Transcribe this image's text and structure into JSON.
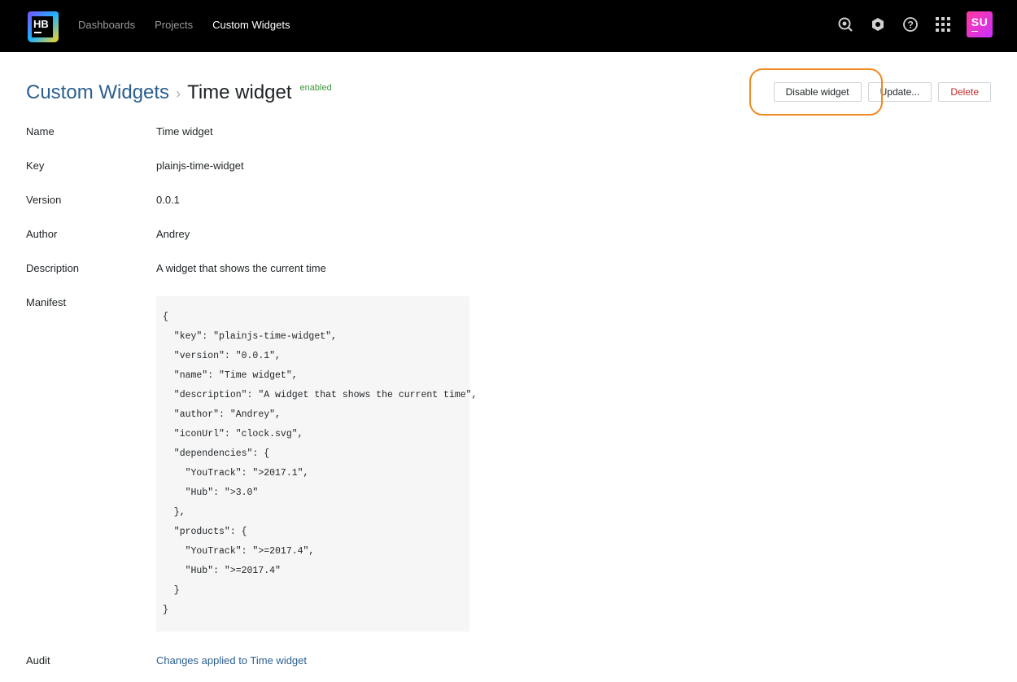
{
  "topbar": {
    "logo_text": "HB",
    "nav": [
      {
        "label": "Dashboards",
        "active": false
      },
      {
        "label": "Projects",
        "active": false
      },
      {
        "label": "Custom Widgets",
        "active": true
      }
    ],
    "icons": [
      "search-icon",
      "settings-icon",
      "help-icon",
      "apps-grid-icon"
    ],
    "avatar_initials": "SU"
  },
  "header": {
    "breadcrumb_link": "Custom Widgets",
    "breadcrumb_separator": "›",
    "title": "Time widget",
    "status": "enabled"
  },
  "actions": {
    "disable_label": "Disable widget",
    "update_label": "Update...",
    "delete_label": "Delete"
  },
  "properties": [
    {
      "label": "Name",
      "value": "Time widget"
    },
    {
      "label": "Key",
      "value": "plainjs-time-widget"
    },
    {
      "label": "Version",
      "value": "0.0.1"
    },
    {
      "label": "Author",
      "value": "Andrey"
    },
    {
      "label": "Description",
      "value": "A widget that shows the current time"
    }
  ],
  "manifest": {
    "label": "Manifest",
    "code": "{\n  \"key\": \"plainjs-time-widget\",\n  \"version\": \"0.0.1\",\n  \"name\": \"Time widget\",\n  \"description\": \"A widget that shows the current time\",\n  \"author\": \"Andrey\",\n  \"iconUrl\": \"clock.svg\",\n  \"dependencies\": {\n    \"YouTrack\": \">2017.1\",\n    \"Hub\": \">3.0\"\n  },\n  \"products\": {\n    \"YouTrack\": \">=2017.4\",\n    \"Hub\": \">=2017.4\"\n  }\n}"
  },
  "audit": {
    "label": "Audit",
    "link_text": "Changes applied to Time widget"
  },
  "colors": {
    "topbar_bg": "#000000",
    "link": "#2a5f8f",
    "status_enabled": "#3c9a3c",
    "danger": "#c22a2a",
    "highlight": "#f08a24"
  }
}
